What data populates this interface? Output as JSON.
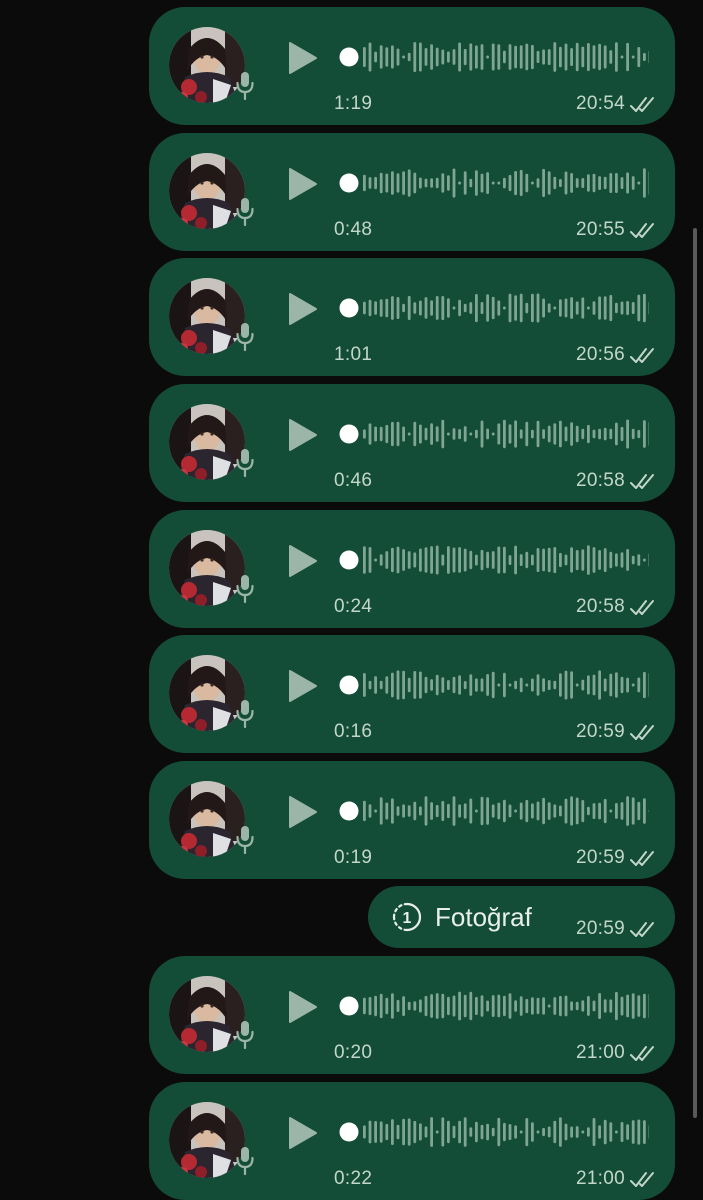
{
  "conversation": {
    "voice_messages": [
      {
        "duration": "1:19",
        "time": "20:54"
      },
      {
        "duration": "0:48",
        "time": "20:55"
      },
      {
        "duration": "1:01",
        "time": "20:56"
      },
      {
        "duration": "0:46",
        "time": "20:58"
      },
      {
        "duration": "0:24",
        "time": "20:58"
      },
      {
        "duration": "0:16",
        "time": "20:59"
      },
      {
        "duration": "0:19",
        "time": "20:59"
      },
      {
        "duration": "0:20",
        "time": "21:00"
      },
      {
        "duration": "0:22",
        "time": "21:00"
      }
    ],
    "photo_message": {
      "label": "Fotoğraf",
      "view_once_count": "1",
      "time": "20:59"
    }
  },
  "theme": {
    "background": "#0b0b0b",
    "bubble": "#144d37",
    "meta_text": "#c2d6cb",
    "waveform": "#7fa593",
    "play_icon": "#9bb5a8"
  },
  "icons": {
    "play": "play-icon",
    "microphone": "microphone-icon",
    "delivered": "double-check-icon",
    "view_once": "view-once-icon"
  }
}
